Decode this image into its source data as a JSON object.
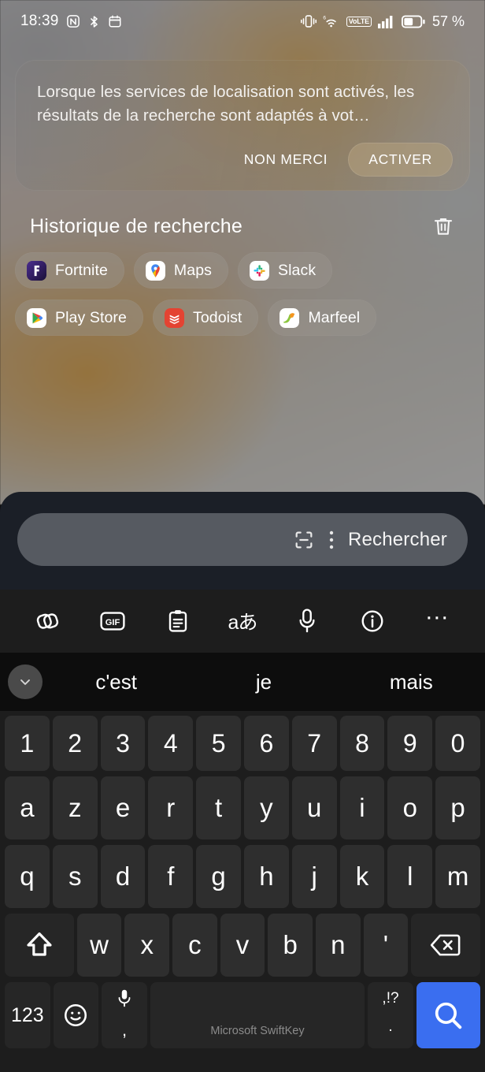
{
  "status_bar": {
    "time": "18:39",
    "left_icons": [
      "nfc-icon",
      "bluetooth-icon",
      "calendar-icon"
    ],
    "right_icons": [
      "vibrate-icon",
      "wifi-6-icon",
      "volte-icon",
      "signal-bars-icon",
      "battery-icon"
    ],
    "volte_label": "VoLTE",
    "battery_percent": "57 %"
  },
  "location_card": {
    "message": "Lorsque les services de localisation sont activés, les résultats de la recherche sont adaptés à vot…",
    "decline_label": "NON MERCI",
    "accept_label": "ACTIVER"
  },
  "history": {
    "title": "Historique de recherche",
    "clear_icon": "trash-icon",
    "rows": [
      [
        {
          "label": "Fortnite",
          "icon": "fortnite-icon"
        },
        {
          "label": "Maps",
          "icon": "google-maps-icon"
        },
        {
          "label": "Slack",
          "icon": "slack-icon"
        }
      ],
      [
        {
          "label": "Play Store",
          "icon": "play-store-icon"
        },
        {
          "label": "Todoist",
          "icon": "todoist-icon"
        },
        {
          "label": "Marfeel",
          "icon": "marfeel-icon"
        }
      ]
    ]
  },
  "search_bar": {
    "value": "",
    "action_label": "Rechercher",
    "lens_icon": "scan-lens-icon",
    "menu_icon": "overflow-menu-icon",
    "panel_color": "#1b1f27",
    "field_color": "#565a61"
  },
  "keyboard": {
    "toolbar": [
      "sticker-icon",
      "gif-icon",
      "clipboard-icon",
      "translate-icon",
      "microphone-icon",
      "info-icon",
      "more-icon"
    ],
    "predictions": [
      "c'est",
      "je",
      "mais"
    ],
    "collapse_icon": "chevron-down-icon",
    "rows": {
      "numbers": [
        "1",
        "2",
        "3",
        "4",
        "5",
        "6",
        "7",
        "8",
        "9",
        "0"
      ],
      "top": [
        "a",
        "z",
        "e",
        "r",
        "t",
        "y",
        "u",
        "i",
        "o",
        "p"
      ],
      "home": [
        "q",
        "s",
        "d",
        "f",
        "g",
        "h",
        "j",
        "k",
        "l",
        "m"
      ],
      "bottom": [
        "w",
        "x",
        "c",
        "v",
        "b",
        "n",
        "'"
      ]
    },
    "shift_icon": "shift-icon",
    "backspace_icon": "backspace-icon",
    "numeric_label": "123",
    "emoji_icon": "emoji-icon",
    "mic_icon": "microphone-icon",
    "comma_label": ",",
    "space_label": "Microsoft SwiftKey",
    "punct_top_label": ",!?",
    "punct_bottom_label": ".",
    "search_key_icon": "search-icon",
    "search_key_color": "#3a6ef0"
  }
}
